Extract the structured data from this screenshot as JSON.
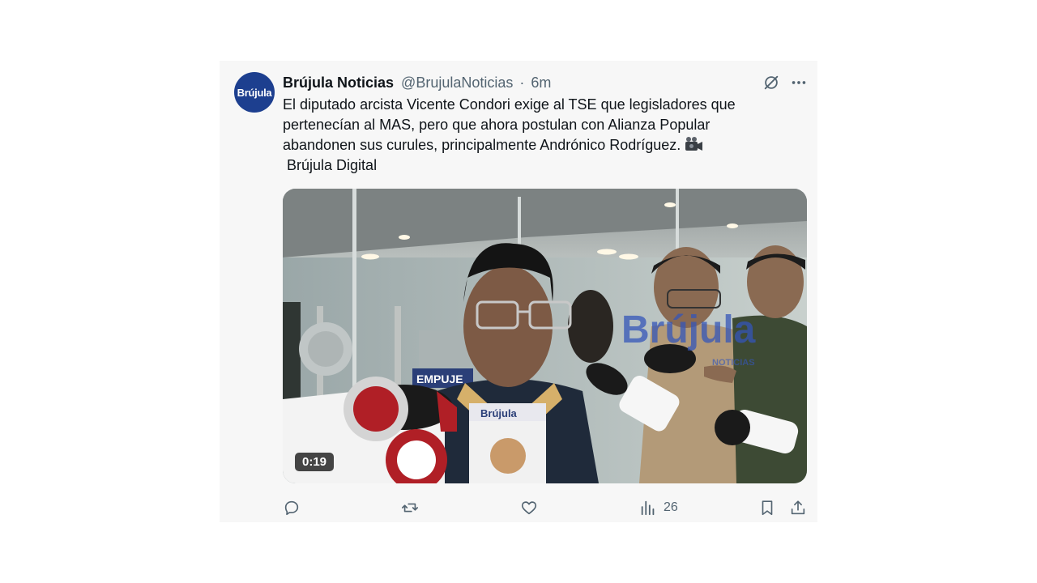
{
  "tweet": {
    "author_name": "Brújula Noticias",
    "handle": "@BrujulaNoticias",
    "separator": "·",
    "time": "6m",
    "avatar_text": "Brújula",
    "text_line1": "El diputado arcista Vicente Condori exige al TSE que legisladores que",
    "text_line2": "pertenecían al MAS, pero que ahora postulan con Alianza Popular",
    "text_line3": "abandonen sus curules, principalmente Andrónico Rodríguez.",
    "text_line4": " Brújula Digital",
    "media": {
      "duration": "0:19",
      "watermark": "Brújula",
      "watermark_sub": "NOTICIAS",
      "banner_text": "EMPUJE",
      "mic_label": "Brújula"
    },
    "actions": {
      "views_count": "26"
    }
  },
  "icons": [
    "grok-icon",
    "more-icon",
    "camera-icon",
    "reply-icon",
    "repost-icon",
    "like-icon",
    "views-icon",
    "bookmark-icon",
    "share-icon"
  ],
  "colors": {
    "card_background": "#f7f7f7",
    "text_primary": "#0f1419",
    "text_secondary": "#536471",
    "avatar_blue": "#1d3f8f"
  }
}
